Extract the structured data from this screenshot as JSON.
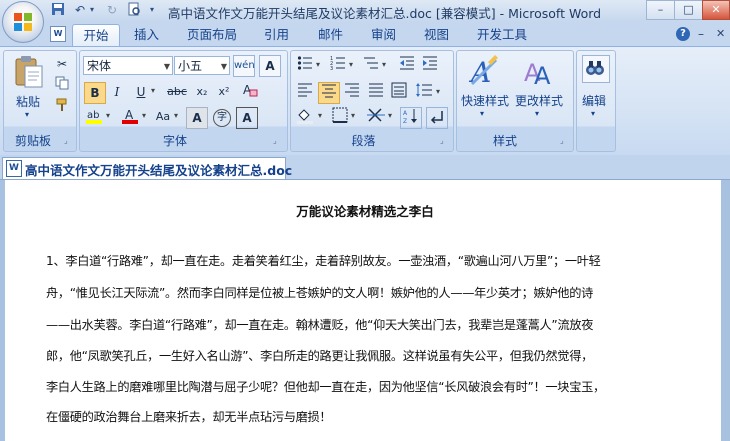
{
  "window": {
    "title": "高中语文作文万能开头结尾及议论素材汇总.doc [兼容模式] - Microsoft Word",
    "minimize": "–",
    "maximize": "□",
    "close": "✕"
  },
  "ribbon_tabs": [
    "开始",
    "插入",
    "页面布局",
    "引用",
    "邮件",
    "审阅",
    "视图",
    "开发工具"
  ],
  "clipboard": {
    "paste_label": "粘贴",
    "group_label": "剪贴板"
  },
  "font": {
    "font_name": "宋体",
    "font_size": "小五",
    "group_label": "字体",
    "bold": "B",
    "italic": "I",
    "underline": "U",
    "strike": "abc",
    "subscript": "x₂",
    "superscript": "x²",
    "size_aa": "Aa",
    "clear": "A",
    "grow": "A",
    "char_border": "A",
    "enclose": "字"
  },
  "paragraph": {
    "group_label": "段落"
  },
  "styles": {
    "quick_styles_label": "快速样式",
    "change_styles_label": "更改样式",
    "group_label": "样式"
  },
  "editing": {
    "label": "编辑"
  },
  "document": {
    "tab_label": "高中语文作文万能开头结尾及议论素材汇总.doc",
    "heading": "万能议论素材精选之李白",
    "lines": [
      "1、李白道“行路难”，却一直在走。走着笑着红尘，走着辞别故友。一壶浊酒，“歌遍山河八万里”；一叶轻",
      "舟，“惟见长江天际流”。然而李白同样是位被上苍嫉妒的文人啊！嫉妒他的人——年少英才；嫉妒他的诗",
      "——出水芙蓉。李白道“行路难”，却一直在走。翰林遭贬，他“仰天大笑出门去，我辈岂是蓬蒿人”流放夜",
      "郎，他“凤歌笑孔丘，一生好入名山游”、李白所走的路更让我佩服。这样说虽有失公平，但我仍然觉得，",
      "李白人生路上的磨难哪里比陶潜与屈子少呢？但他却一直在走，因为他坚信“长风破浪会有时”！一块宝玉，",
      "在僵硬的政治舞台上磨来折去，却无半点玷污与磨损！"
    ]
  },
  "colors": {
    "ribbon_accent": "#15428b",
    "highlight_yellow": "#ffff00",
    "font_color_red": "#e00000"
  }
}
